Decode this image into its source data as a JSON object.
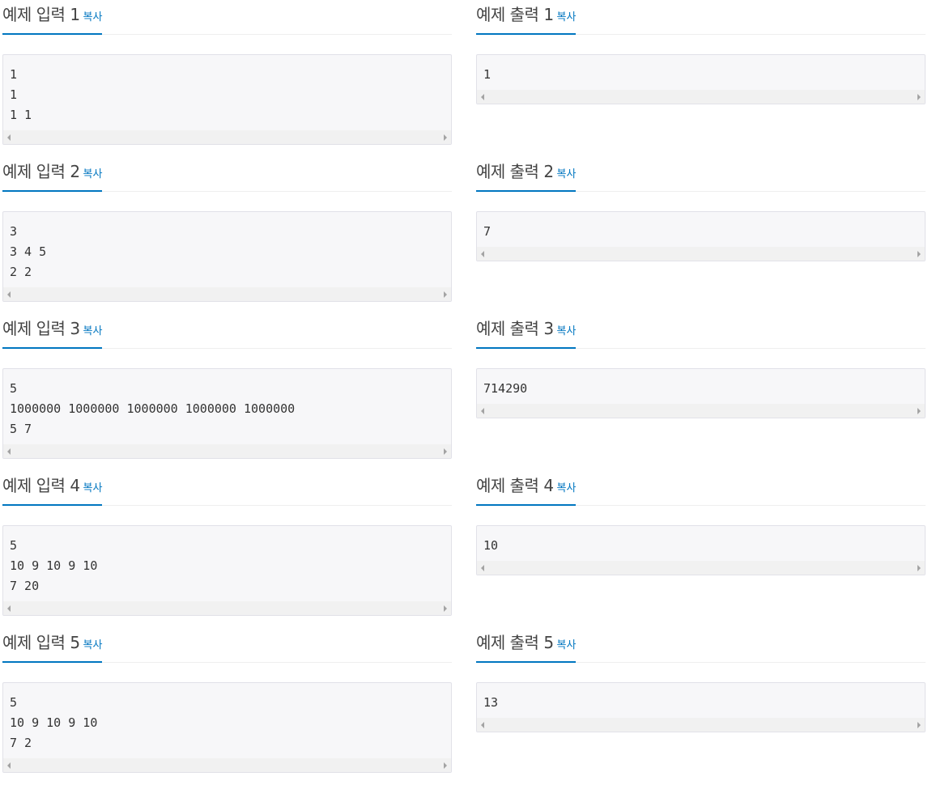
{
  "copy_label": "복사",
  "samples": [
    {
      "input_title": "예제 입력 1",
      "input_text": "1\n1\n1 1",
      "output_title": "예제 출력 1",
      "output_text": "1"
    },
    {
      "input_title": "예제 입력 2",
      "input_text": "3\n3 4 5\n2 2",
      "output_title": "예제 출력 2",
      "output_text": "7"
    },
    {
      "input_title": "예제 입력 3",
      "input_text": "5\n1000000 1000000 1000000 1000000 1000000\n5 7",
      "output_title": "예제 출력 3",
      "output_text": "714290"
    },
    {
      "input_title": "예제 입력 4",
      "input_text": "5\n10 9 10 9 10\n7 20",
      "output_title": "예제 출력 4",
      "output_text": "10"
    },
    {
      "input_title": "예제 입력 5",
      "input_text": "5\n10 9 10 9 10\n7 2",
      "output_title": "예제 출력 5",
      "output_text": "13"
    }
  ]
}
